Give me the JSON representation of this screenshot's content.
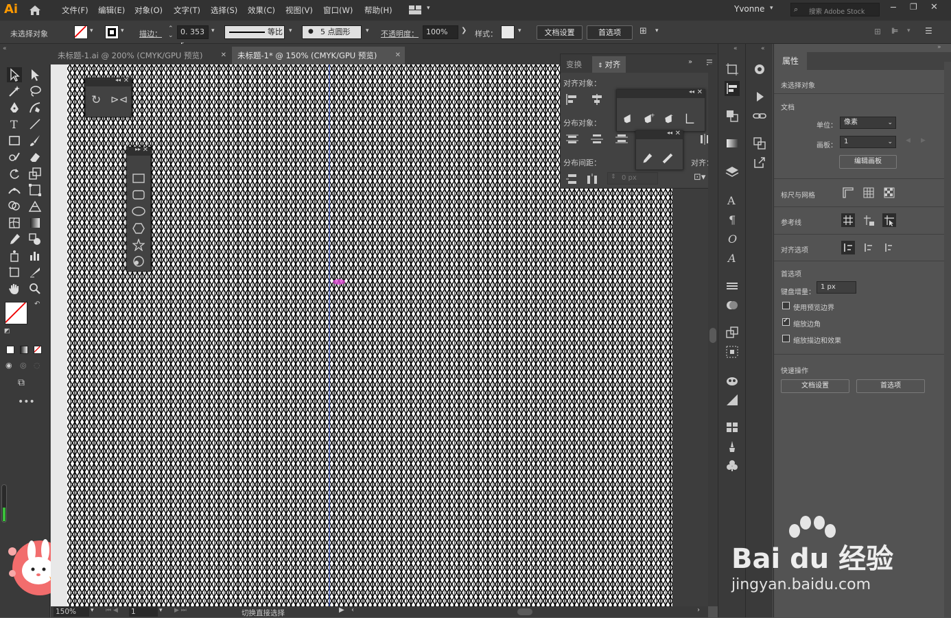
{
  "app": {
    "logo": "Ai",
    "user": "Yvonne",
    "search_placeholder": "搜索 Adobe Stock"
  },
  "menu": [
    "文件(F)",
    "编辑(E)",
    "对象(O)",
    "文字(T)",
    "选择(S)",
    "效果(C)",
    "视图(V)",
    "窗口(W)",
    "帮助(H)"
  ],
  "control": {
    "selection": "未选择对象",
    "stroke_label": "描边：",
    "stroke_value": "0. 353 r",
    "stroke_profile": "等比",
    "brush": "5 点圆形",
    "opacity_label": "不透明度：",
    "opacity_value": "100%",
    "style_label": "样式：",
    "doc_setup": "文档设置",
    "prefs": "首选项"
  },
  "tabs": [
    {
      "label": "未标题-1.ai @ 200% (CMYK/GPU 预览)",
      "active": false
    },
    {
      "label": "未标题-1* @ 150% (CMYK/GPU 预览)",
      "active": true
    }
  ],
  "align_panel": {
    "tab_transform": "变换",
    "tab_align": "对齐",
    "align_objects": "对齐对象：",
    "distribute_objects": "分布对象：",
    "distribute_spacing": "分布间距：",
    "align_to": "对齐：",
    "spacing_value": "0 px"
  },
  "status": {
    "zoom": "150%",
    "artboard": "1",
    "message": "切换直接选择"
  },
  "properties": {
    "tab": "属性",
    "no_selection": "未选择对象",
    "document": "文档",
    "units_label": "单位：",
    "units_value": "像素",
    "artboard_label": "画板：",
    "artboard_value": "1",
    "edit_artboard": "编辑画板",
    "rulers_grids": "标尺与网格",
    "guides": "参考线",
    "snap_options": "对齐选项",
    "preferences": "首选项",
    "keyboard_increment_label": "键盘增量：",
    "keyboard_increment_value": "1 px",
    "use_preview_bounds": "使用预览边界",
    "scale_corners": "缩放边角",
    "scale_strokes": "缩放描边和效果",
    "quick_actions": "快速操作",
    "qa_doc_setup": "文档设置",
    "qa_prefs": "首选项"
  },
  "checkboxes": {
    "use_preview_bounds": false,
    "scale_corners": true,
    "scale_strokes": false
  },
  "watermark": {
    "logo": "Bai du 经验",
    "url": "jingyan.baidu.com"
  },
  "colors": {
    "accent_orange": "#ff9a00",
    "ui_dark": "#323232",
    "panel": "#535353"
  }
}
